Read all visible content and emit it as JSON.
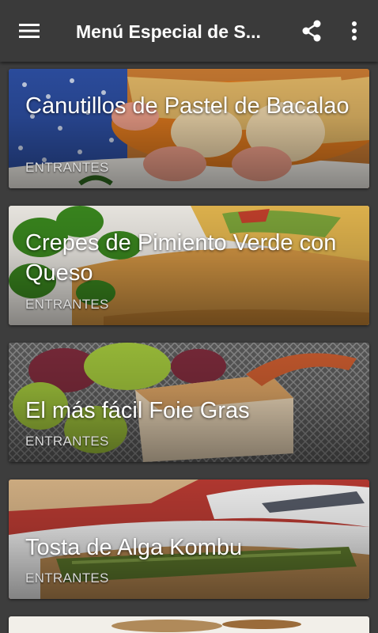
{
  "appbar": {
    "title": "Menú Especial de S...",
    "icons": [
      "hamburger-menu-icon",
      "share-icon",
      "more-vert-icon"
    ]
  },
  "recipes": [
    {
      "title": "Canutillos de Pastel de Bacalao",
      "category": "ENTRANTES"
    },
    {
      "title": "Crepes de Pimiento Verde con Queso",
      "category": "ENTRANTES"
    },
    {
      "title": "El más fácil Foie Gras",
      "category": "ENTRANTES"
    },
    {
      "title": "Tosta de Alga Kombu",
      "category": "ENTRANTES"
    }
  ],
  "colors": {
    "background": "#3d3d3d",
    "appbar": "#3a3a3a",
    "text": "#ffffff",
    "category_text": "#dadada"
  }
}
